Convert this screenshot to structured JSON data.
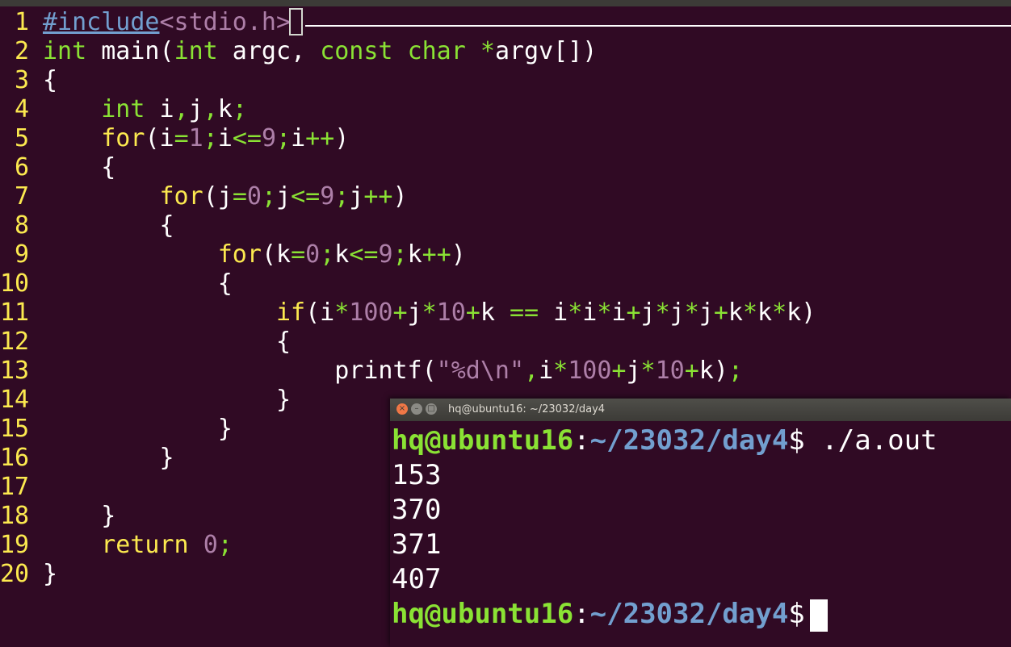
{
  "editor": {
    "lines": [
      {
        "num": "1",
        "segs": [
          {
            "c": "p",
            "t": "#include"
          },
          {
            "c": "s",
            "t": "<stdio.h>"
          }
        ]
      },
      {
        "num": "2",
        "segs": [
          {
            "c": "t",
            "t": "int"
          },
          {
            "c": "o",
            "t": " main("
          },
          {
            "c": "t",
            "t": "int"
          },
          {
            "c": "o",
            "t": " argc"
          },
          {
            "c": "o",
            "t": ", "
          },
          {
            "c": "t",
            "t": "const"
          },
          {
            "c": "o",
            "t": " "
          },
          {
            "c": "t",
            "t": "char"
          },
          {
            "c": "o",
            "t": " "
          },
          {
            "c": "t",
            "t": "*"
          },
          {
            "c": "o",
            "t": "argv[])"
          }
        ]
      },
      {
        "num": "3",
        "segs": [
          {
            "c": "o",
            "t": "{"
          }
        ]
      },
      {
        "num": "4",
        "segs": [
          {
            "c": "o",
            "t": "    "
          },
          {
            "c": "t",
            "t": "int"
          },
          {
            "c": "o",
            "t": " i"
          },
          {
            "c": "t",
            "t": ","
          },
          {
            "c": "o",
            "t": "j"
          },
          {
            "c": "t",
            "t": ","
          },
          {
            "c": "o",
            "t": "k"
          },
          {
            "c": "t",
            "t": ";"
          }
        ]
      },
      {
        "num": "5",
        "segs": [
          {
            "c": "o",
            "t": "    "
          },
          {
            "c": "k",
            "t": "for"
          },
          {
            "c": "o",
            "t": "(i"
          },
          {
            "c": "t",
            "t": "="
          },
          {
            "c": "n",
            "t": "1"
          },
          {
            "c": "t",
            "t": ";"
          },
          {
            "c": "o",
            "t": "i"
          },
          {
            "c": "t",
            "t": "<="
          },
          {
            "c": "n",
            "t": "9"
          },
          {
            "c": "t",
            "t": ";"
          },
          {
            "c": "o",
            "t": "i"
          },
          {
            "c": "t",
            "t": "++"
          },
          {
            "c": "o",
            "t": ")"
          }
        ]
      },
      {
        "num": "6",
        "segs": [
          {
            "c": "o",
            "t": "    {"
          }
        ]
      },
      {
        "num": "7",
        "segs": [
          {
            "c": "o",
            "t": "        "
          },
          {
            "c": "k",
            "t": "for"
          },
          {
            "c": "o",
            "t": "(j"
          },
          {
            "c": "t",
            "t": "="
          },
          {
            "c": "n",
            "t": "0"
          },
          {
            "c": "t",
            "t": ";"
          },
          {
            "c": "o",
            "t": "j"
          },
          {
            "c": "t",
            "t": "<="
          },
          {
            "c": "n",
            "t": "9"
          },
          {
            "c": "t",
            "t": ";"
          },
          {
            "c": "o",
            "t": "j"
          },
          {
            "c": "t",
            "t": "++"
          },
          {
            "c": "o",
            "t": ")"
          }
        ]
      },
      {
        "num": "8",
        "segs": [
          {
            "c": "o",
            "t": "        {"
          }
        ]
      },
      {
        "num": "9",
        "segs": [
          {
            "c": "o",
            "t": "            "
          },
          {
            "c": "k",
            "t": "for"
          },
          {
            "c": "o",
            "t": "(k"
          },
          {
            "c": "t",
            "t": "="
          },
          {
            "c": "n",
            "t": "0"
          },
          {
            "c": "t",
            "t": ";"
          },
          {
            "c": "o",
            "t": "k"
          },
          {
            "c": "t",
            "t": "<="
          },
          {
            "c": "n",
            "t": "9"
          },
          {
            "c": "t",
            "t": ";"
          },
          {
            "c": "o",
            "t": "k"
          },
          {
            "c": "t",
            "t": "++"
          },
          {
            "c": "o",
            "t": ")"
          }
        ]
      },
      {
        "num": "10",
        "segs": [
          {
            "c": "o",
            "t": "            {"
          }
        ]
      },
      {
        "num": "11",
        "segs": [
          {
            "c": "o",
            "t": "                "
          },
          {
            "c": "k",
            "t": "if"
          },
          {
            "c": "o",
            "t": "(i"
          },
          {
            "c": "t",
            "t": "*"
          },
          {
            "c": "n",
            "t": "100"
          },
          {
            "c": "t",
            "t": "+"
          },
          {
            "c": "o",
            "t": "j"
          },
          {
            "c": "t",
            "t": "*"
          },
          {
            "c": "n",
            "t": "10"
          },
          {
            "c": "t",
            "t": "+"
          },
          {
            "c": "o",
            "t": "k "
          },
          {
            "c": "t",
            "t": "=="
          },
          {
            "c": "o",
            "t": " i"
          },
          {
            "c": "t",
            "t": "*"
          },
          {
            "c": "o",
            "t": "i"
          },
          {
            "c": "t",
            "t": "*"
          },
          {
            "c": "o",
            "t": "i"
          },
          {
            "c": "t",
            "t": "+"
          },
          {
            "c": "o",
            "t": "j"
          },
          {
            "c": "t",
            "t": "*"
          },
          {
            "c": "o",
            "t": "j"
          },
          {
            "c": "t",
            "t": "*"
          },
          {
            "c": "o",
            "t": "j"
          },
          {
            "c": "t",
            "t": "+"
          },
          {
            "c": "o",
            "t": "k"
          },
          {
            "c": "t",
            "t": "*"
          },
          {
            "c": "o",
            "t": "k"
          },
          {
            "c": "t",
            "t": "*"
          },
          {
            "c": "o",
            "t": "k)"
          }
        ]
      },
      {
        "num": "12",
        "segs": [
          {
            "c": "o",
            "t": "                {"
          }
        ]
      },
      {
        "num": "13",
        "segs": [
          {
            "c": "o",
            "t": "                    printf("
          },
          {
            "c": "str",
            "t": "\"%d\\n\""
          },
          {
            "c": "t",
            "t": ","
          },
          {
            "c": "o",
            "t": "i"
          },
          {
            "c": "t",
            "t": "*"
          },
          {
            "c": "n",
            "t": "100"
          },
          {
            "c": "t",
            "t": "+"
          },
          {
            "c": "o",
            "t": "j"
          },
          {
            "c": "t",
            "t": "*"
          },
          {
            "c": "n",
            "t": "10"
          },
          {
            "c": "t",
            "t": "+"
          },
          {
            "c": "o",
            "t": "k)"
          },
          {
            "c": "t",
            "t": ";"
          }
        ]
      },
      {
        "num": "14",
        "segs": [
          {
            "c": "o",
            "t": "                }"
          }
        ]
      },
      {
        "num": "15",
        "segs": [
          {
            "c": "o",
            "t": "            }"
          }
        ]
      },
      {
        "num": "16",
        "segs": [
          {
            "c": "o",
            "t": "        }"
          }
        ]
      },
      {
        "num": "17",
        "segs": []
      },
      {
        "num": "18",
        "segs": [
          {
            "c": "o",
            "t": "    }"
          }
        ]
      },
      {
        "num": "19",
        "segs": [
          {
            "c": "o",
            "t": "    "
          },
          {
            "c": "k",
            "t": "return"
          },
          {
            "c": "o",
            "t": " "
          },
          {
            "c": "n",
            "t": "0"
          },
          {
            "c": "t",
            "t": ";"
          }
        ]
      },
      {
        "num": "20",
        "segs": [
          {
            "c": "o",
            "t": "}"
          }
        ]
      }
    ]
  },
  "terminal": {
    "title": "hq@ubuntu16: ~/23032/day4",
    "close_glyph": "×",
    "min_glyph": "–",
    "max_glyph": "□",
    "prompt_user": "hq@ubuntu16",
    "prompt_sep": ":",
    "prompt_path": "~/23032/day4",
    "prompt_dollar": "$",
    "command": " ./a.out",
    "output": [
      "153",
      "370",
      "371",
      "407"
    ]
  },
  "colors": {
    "background": "#300a24",
    "line_number": "#fce94f",
    "keyword": "#fce94f",
    "type": "#8ae234",
    "number": "#ad7fa8",
    "preproc": "#729fcf",
    "prompt_user": "#8ae234",
    "prompt_path": "#729fcf"
  }
}
